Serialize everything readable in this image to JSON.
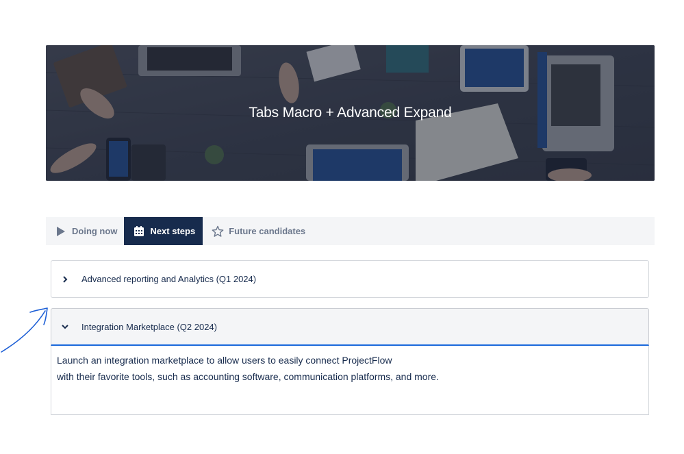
{
  "banner": {
    "title": "Tabs Macro + Advanced Expand"
  },
  "tabs": [
    {
      "label": "Doing now",
      "icon": "play-icon",
      "active": false
    },
    {
      "label": "Next steps",
      "icon": "calendar-icon",
      "active": true
    },
    {
      "label": "Future candidates",
      "icon": "star-icon",
      "active": false
    }
  ],
  "expands": [
    {
      "title": "Advanced reporting and Analytics (Q1 2024)",
      "expanded": false
    },
    {
      "title": "Integration Marketplace (Q2 2024)",
      "expanded": true,
      "body_line1": "Launch an integration marketplace to allow users to easily connect ProjectFlow",
      "body_line2": "with their favorite tools, such as accounting software, communication platforms, and more."
    }
  ],
  "colors": {
    "active_tab_bg": "#172b4d",
    "tabbar_bg": "#f4f5f7",
    "expanded_underline": "#1868db",
    "annotation_arrow": "#1d5fd6"
  }
}
